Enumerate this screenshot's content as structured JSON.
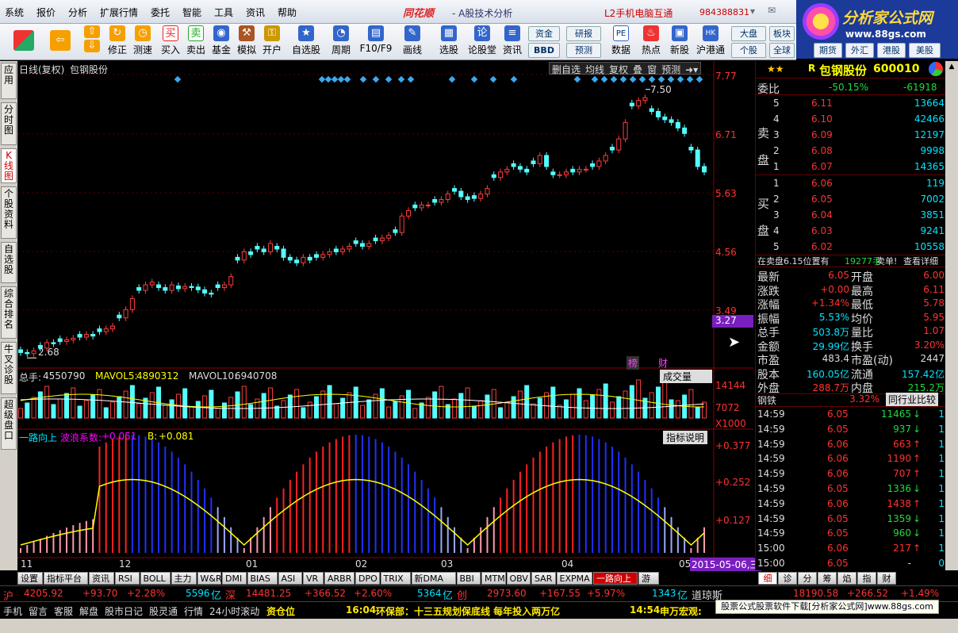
{
  "menu": [
    "系统",
    "报价",
    "分析",
    "扩展行情",
    "委托",
    "智能",
    "工具",
    "资讯",
    "帮助"
  ],
  "brand": "同花顺",
  "brand_sub": "- A股技术分析",
  "l2_link": "L2手机电脑互通",
  "account": "984388831",
  "logo": {
    "name": "分析家公式网",
    "url": "www.88gs.com"
  },
  "toolbar": [
    {
      "label": "",
      "icon": "layout-icon",
      "color": "#d33"
    },
    {
      "label": "",
      "icon": "back-arrow-icon",
      "color": "#f5a000"
    },
    {
      "label": "修正",
      "icon": "refresh-icon",
      "color": "#f5a000"
    },
    {
      "label": "测速",
      "icon": "clock-icon",
      "color": "#f5a000"
    },
    {
      "label": "买入",
      "icon": "buy-icon",
      "color": "#e22"
    },
    {
      "label": "卖出",
      "icon": "sell-icon",
      "color": "#2a2"
    },
    {
      "label": "基金",
      "icon": "fund-icon",
      "color": "#36c"
    },
    {
      "label": "模拟",
      "icon": "hammer-icon",
      "color": "#a52"
    },
    {
      "label": "开户",
      "icon": "lock-icon",
      "color": "#c90"
    },
    {
      "label": "自选股",
      "icon": "star-icon",
      "color": "#36c"
    },
    {
      "label": "周期",
      "icon": "period-icon",
      "color": "#36c"
    },
    {
      "label": "F10/F9",
      "icon": "f10-icon",
      "color": "#36c"
    },
    {
      "label": "画线",
      "icon": "pen-icon",
      "color": "#36c"
    },
    {
      "label": "选股",
      "icon": "select-icon",
      "color": "#36c"
    },
    {
      "label": "论股堂",
      "icon": "forum-icon",
      "color": "#36c"
    },
    {
      "label": "资讯",
      "icon": "news-icon",
      "color": "#36c"
    }
  ],
  "tool_buttons": [
    "资金",
    "BBD",
    "研报",
    "预测",
    "PE",
    "数据",
    "热点",
    "新股",
    "沪港通",
    "大盘",
    "个股",
    "板块",
    "全球",
    "期货",
    "外汇",
    "港股",
    "美股"
  ],
  "side_tabs": [
    "应用",
    "分时图",
    "K线图",
    "个股资料",
    "自选股",
    "综合排名",
    "牛叉诊股",
    "超级盘口"
  ],
  "chart": {
    "title_left": "日线(复权)",
    "stock_name": "包钢股份",
    "buttons": [
      "删自选",
      "均线",
      "复权",
      "叠",
      "窗",
      "预测"
    ],
    "price_axis": [
      "7.77",
      "6.71",
      "5.63",
      "4.56",
      "3.49"
    ],
    "current_price_tag": "3.27",
    "high_label": "7.50",
    "low_label": "2.68",
    "markers": [
      "榜",
      "财"
    ],
    "volume": {
      "label": "总手:",
      "value": "4550790",
      "ma5_label": "MAVOL5:",
      "ma5": "4890312",
      "ma10_label": "MAVOL10:",
      "ma10": "6940708",
      "menu": "成交量",
      "axis": [
        "14144",
        "7072",
        "X1000"
      ]
    },
    "indicator": {
      "name": "一路向上",
      "coef_label": "波浪系数:",
      "coef": "+0.051",
      "b_label": "B:",
      "b": "+0.081",
      "button": "指标说明",
      "axis": [
        "+0.377",
        "+0.252",
        "+0.127"
      ]
    },
    "months": [
      "11",
      "12",
      "01",
      "02",
      "03",
      "04",
      "05"
    ],
    "date_tag": "2015-05-06,三"
  },
  "quote": {
    "name": "包钢股份",
    "code": "600010",
    "prefix": "R",
    "wei_label": "委比",
    "wei_pct": "-50.15%",
    "wei_diff": "-61918",
    "sell_label": "卖盘",
    "buy_label": "买盘",
    "sell": [
      {
        "n": "5",
        "p": "6.11",
        "v": "13664"
      },
      {
        "n": "4",
        "p": "6.10",
        "v": "42466"
      },
      {
        "n": "3",
        "p": "6.09",
        "v": "12197"
      },
      {
        "n": "2",
        "p": "6.08",
        "v": "9998"
      },
      {
        "n": "1",
        "p": "6.07",
        "v": "14365"
      }
    ],
    "buy": [
      {
        "n": "1",
        "p": "6.06",
        "v": "119"
      },
      {
        "n": "2",
        "p": "6.05",
        "v": "7002"
      },
      {
        "n": "3",
        "p": "6.04",
        "v": "3851"
      },
      {
        "n": "4",
        "p": "6.03",
        "v": "9241"
      },
      {
        "n": "5",
        "p": "6.02",
        "v": "10558"
      }
    ],
    "note_left": "在卖盘6.15位置有",
    "note_vol": "19277手",
    "note_right": "卖单!",
    "note_link": "查看详细",
    "stats": [
      [
        "最新",
        "6.05",
        "开盘",
        "6.00"
      ],
      [
        "涨跌",
        "+0.00",
        "最高",
        "6.11"
      ],
      [
        "涨幅",
        "+1.34%",
        "最低",
        "5.78"
      ],
      [
        "振幅",
        "5.53%",
        "均价",
        "5.95"
      ],
      [
        "总手",
        "503.8万",
        "量比",
        "1.07"
      ],
      [
        "金额",
        "29.99亿",
        "换手",
        "3.20%"
      ],
      [
        "市盈",
        "483.4",
        "市盈(动)",
        "2447"
      ],
      [
        "股本",
        "160.05亿",
        "流通",
        "157.42亿"
      ],
      [
        "外盘",
        "288.7万",
        "内盘",
        "215.2万"
      ]
    ],
    "sector": "钢铁",
    "sector_pct": "3.32%",
    "sector_btn": "同行业比较",
    "ticks": [
      [
        "14:59",
        "6.05",
        "11465",
        "1"
      ],
      [
        "14:59",
        "6.05",
        "937",
        "1"
      ],
      [
        "14:59",
        "6.06",
        "663",
        "1"
      ],
      [
        "14:59",
        "6.06",
        "1190",
        "1"
      ],
      [
        "14:59",
        "6.06",
        "707",
        "1"
      ],
      [
        "14:59",
        "6.05",
        "1336",
        "1"
      ],
      [
        "14:59",
        "6.06",
        "1438",
        "1"
      ],
      [
        "14:59",
        "6.05",
        "1359",
        "1"
      ],
      [
        "14:59",
        "6.05",
        "960",
        "1"
      ],
      [
        "15:00",
        "6.06",
        "217",
        "1"
      ],
      [
        "15:00",
        "6.05",
        "-",
        "0"
      ]
    ]
  },
  "bottom_tabs": [
    "设置",
    "指标平台",
    "资讯",
    "RSI",
    "BOLL",
    "主力",
    "W&R",
    "DMI",
    "BIAS",
    "ASI",
    "VR",
    "ARBR",
    "DPO",
    "TRIX",
    "新DMA",
    "BBI",
    "MTM",
    "OBV",
    "SAR",
    "EXPMA",
    "一路向上",
    "游"
  ],
  "right_tabs": [
    "细",
    "诊",
    "分",
    "筹",
    "焰",
    "指",
    "财"
  ],
  "index_bar": [
    {
      "name": "沪",
      "v": "4205.92",
      "d": "+93.70",
      "p": "+2.28%",
      "amt": "5596",
      "u": "亿"
    },
    {
      "name": "深",
      "v": "14481.25",
      "d": "+366.52",
      "p": "+2.60%",
      "amt": "5364",
      "u": "亿"
    },
    {
      "name": "创",
      "v": "2973.60",
      "d": "+167.55",
      "p": "+5.97%",
      "amt": "1343",
      "u": "亿"
    },
    {
      "name": "道琼斯",
      "v": "18190.58",
      "d": "+266.52",
      "p": "+1.49%"
    }
  ],
  "status_items": [
    "手机",
    "留言",
    "客服",
    "解盘",
    "股市日记",
    "股灵通",
    "行情",
    "24小时滚动",
    "资仓位"
  ],
  "news": [
    {
      "t": "16:04",
      "txt": "环保部：十三五规划保底线 每年投入两万亿"
    },
    {
      "t": "14:54",
      "txt": "申万宏观:"
    }
  ],
  "ad": "股票公式股票软件下载[分析家公式网]www.88gs.com"
}
